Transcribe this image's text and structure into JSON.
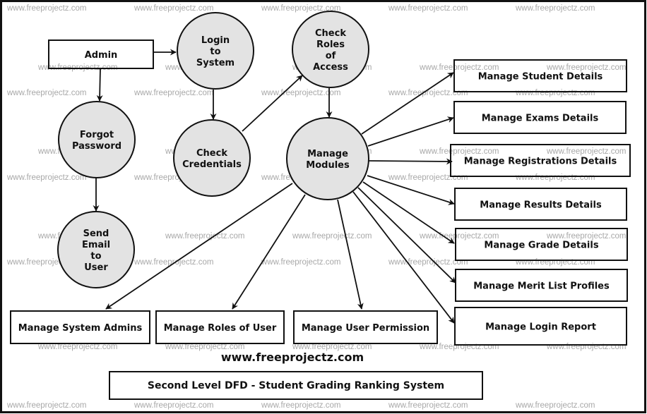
{
  "diagram": {
    "title": "Second Level DFD - Student Grading Ranking System",
    "website": "www.freeprojectz.com",
    "watermark": "www.freeprojectz.com",
    "colors": {
      "process_fill": "#e3e3e3",
      "stroke": "#111111",
      "watermark": "#a8a8a8",
      "background": "#ffffff"
    },
    "entities": [
      {
        "id": "admin",
        "label": "Admin"
      },
      {
        "id": "student_details",
        "label": "Manage Student Details"
      },
      {
        "id": "exams_details",
        "label": "Manage Exams Details"
      },
      {
        "id": "registrations_details",
        "label": "Manage Registrations Details"
      },
      {
        "id": "results_details",
        "label": "Manage Results Details"
      },
      {
        "id": "grade_details",
        "label": "Manage Grade Details"
      },
      {
        "id": "merit_list",
        "label": "Manage Merit List Profiles"
      },
      {
        "id": "login_report",
        "label": "Manage Login Report"
      },
      {
        "id": "system_admins",
        "label": "Manage System Admins"
      },
      {
        "id": "roles_of_user",
        "label": "Manage Roles of User"
      },
      {
        "id": "user_permission",
        "label": "Manage User Permission"
      }
    ],
    "processes": [
      {
        "id": "login",
        "lines": [
          "Login",
          "to",
          "System"
        ]
      },
      {
        "id": "forgot",
        "lines": [
          "Forgot",
          "Password"
        ]
      },
      {
        "id": "send_email",
        "lines": [
          "Send",
          "Email",
          "to",
          "User"
        ]
      },
      {
        "id": "check_cred",
        "lines": [
          "Check",
          "Credentials"
        ]
      },
      {
        "id": "check_roles",
        "lines": [
          "Check",
          "Roles",
          "of",
          "Access"
        ]
      },
      {
        "id": "manage_modules",
        "lines": [
          "Manage",
          "Modules"
        ]
      }
    ],
    "flows": [
      {
        "from": "admin",
        "to": "login"
      },
      {
        "from": "admin",
        "to": "forgot"
      },
      {
        "from": "forgot",
        "to": "send_email"
      },
      {
        "from": "login",
        "to": "check_cred"
      },
      {
        "from": "check_cred",
        "to": "check_roles"
      },
      {
        "from": "check_roles",
        "to": "manage_modules"
      },
      {
        "from": "manage_modules",
        "to": "student_details"
      },
      {
        "from": "manage_modules",
        "to": "exams_details"
      },
      {
        "from": "manage_modules",
        "to": "registrations_details"
      },
      {
        "from": "manage_modules",
        "to": "results_details"
      },
      {
        "from": "manage_modules",
        "to": "grade_details"
      },
      {
        "from": "manage_modules",
        "to": "merit_list"
      },
      {
        "from": "manage_modules",
        "to": "login_report"
      },
      {
        "from": "manage_modules",
        "to": "system_admins"
      },
      {
        "from": "manage_modules",
        "to": "roles_of_user"
      },
      {
        "from": "manage_modules",
        "to": "user_permission"
      }
    ]
  }
}
